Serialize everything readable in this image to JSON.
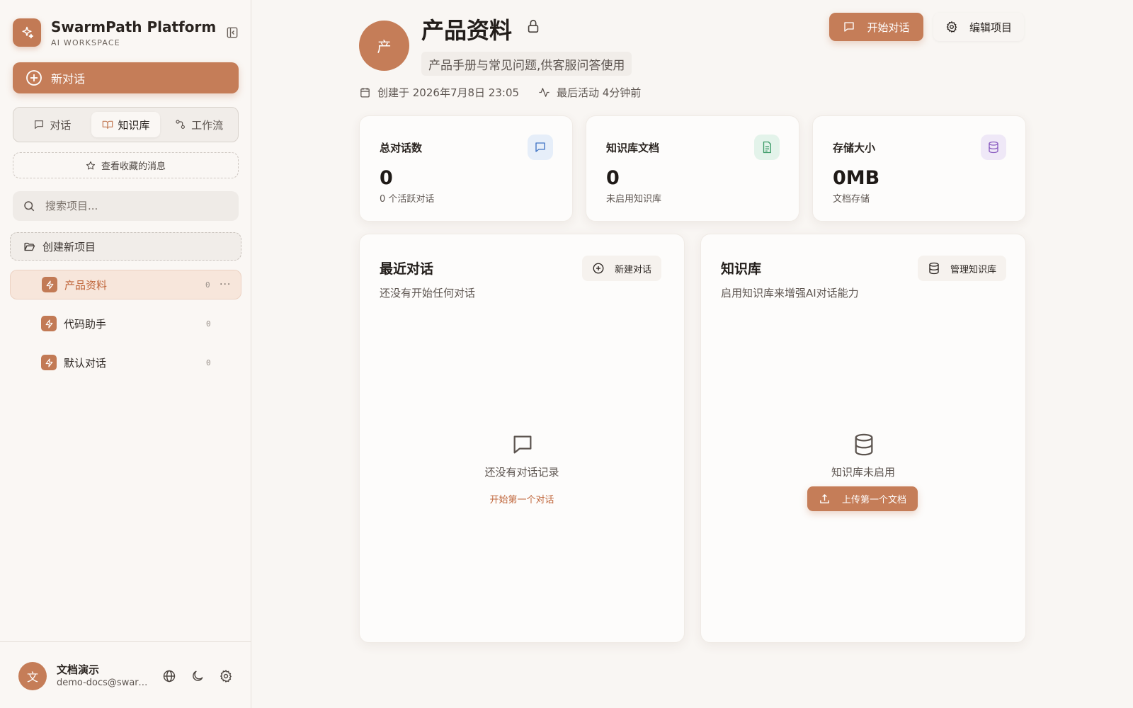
{
  "brand": {
    "title": "SwarmPath Platform",
    "subtitle": "AI WORKSPACE",
    "logo_icon": "sparkles-icon"
  },
  "sidebar": {
    "new_chat_label": "新对话",
    "tabs": [
      {
        "label": "对话",
        "icon": "message-square-icon",
        "active": false
      },
      {
        "label": "知识库",
        "icon": "book-open-icon",
        "active": true
      },
      {
        "label": "工作流",
        "icon": "workflow-icon",
        "active": false
      }
    ],
    "starred_label": "查看收藏的消息",
    "search_placeholder": "搜索项目...",
    "create_project_label": "创建新项目",
    "projects": [
      {
        "name": "产品资料",
        "count": "0",
        "active": true
      },
      {
        "name": "代码助手",
        "count": "0",
        "active": false
      },
      {
        "name": "默认对话",
        "count": "0",
        "active": false
      }
    ],
    "more_label": "···"
  },
  "user": {
    "initial": "文",
    "name": "文档演示",
    "email": "demo-docs@swarmpath.ai"
  },
  "project": {
    "initial": "产",
    "title": "产品资料",
    "description": "产品手册与常见问题,供客服问答使用",
    "created": "创建于 2026年7月8日 23:05",
    "last_activity": "最后活动 4分钟前"
  },
  "actions": {
    "start_chat": "开始对话",
    "edit_project": "编辑项目"
  },
  "stats": [
    {
      "label": "总对话数",
      "value": "0",
      "sub": "0 个活跃对话",
      "icon": "message-square-icon",
      "tint": "#e6eef9",
      "color": "#3f73c4"
    },
    {
      "label": "知识库文档",
      "value": "0",
      "sub": "未启用知识库",
      "icon": "file-text-icon",
      "tint": "#e3f3ea",
      "color": "#3a9a66"
    },
    {
      "label": "存储大小",
      "value": "0MB",
      "sub": "文档存储",
      "icon": "database-icon",
      "tint": "#efe8f7",
      "color": "#8a5cc0"
    }
  ],
  "recent": {
    "title": "最近对话",
    "subtitle": "还没有开始任何对话",
    "new_button": "新建对话",
    "empty_text": "还没有对话记录",
    "empty_link": "开始第一个对话"
  },
  "kb": {
    "title": "知识库",
    "subtitle": "启用知识库来增强AI对话能力",
    "manage_button": "管理知识库",
    "empty_text": "知识库未启用",
    "upload_button": "上传第一个文档"
  },
  "colors": {
    "accent": "#c57d58",
    "accent_text": "#c0663b",
    "background": "#f9f6f3"
  }
}
